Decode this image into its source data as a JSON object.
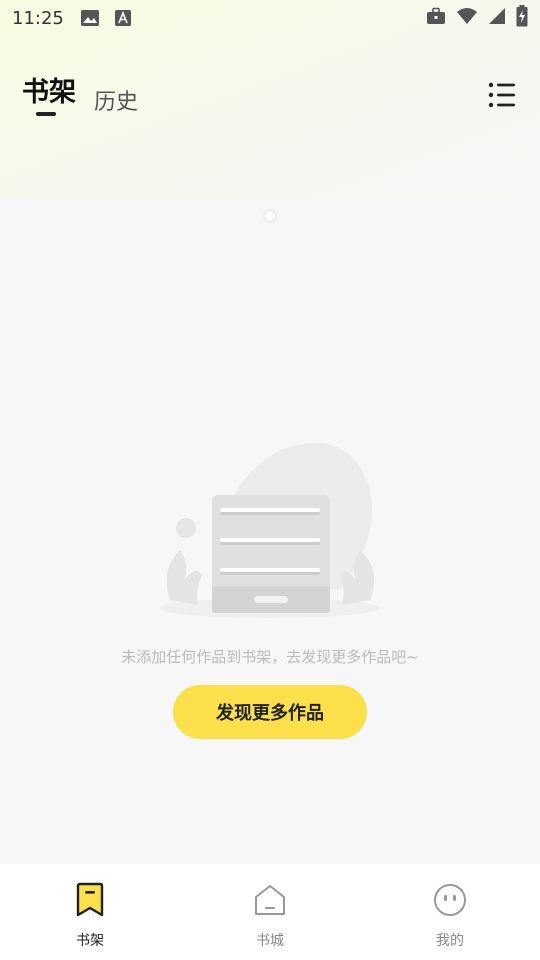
{
  "status_bar": {
    "time": "11:25",
    "icons": [
      "image-icon",
      "font-a-icon",
      "briefcase-icon",
      "wifi-icon",
      "signal-icon",
      "battery-charging-icon"
    ]
  },
  "header": {
    "tabs": [
      {
        "label": "书架",
        "active": true
      },
      {
        "label": "历史",
        "active": false
      }
    ],
    "menu_icon": "list-menu-icon"
  },
  "empty_state": {
    "message": "未添加任何作品到书架，去发现更多作品吧~",
    "button_label": "发现更多作品"
  },
  "bottom_nav": {
    "items": [
      {
        "label": "书架",
        "icon": "bookmark-icon",
        "active": true
      },
      {
        "label": "书城",
        "icon": "home-icon",
        "active": false
      },
      {
        "label": "我的",
        "icon": "face-icon",
        "active": false
      }
    ]
  },
  "colors": {
    "accent": "#fbe04c",
    "text_primary": "#222222",
    "text_muted": "#bbbbbb"
  }
}
